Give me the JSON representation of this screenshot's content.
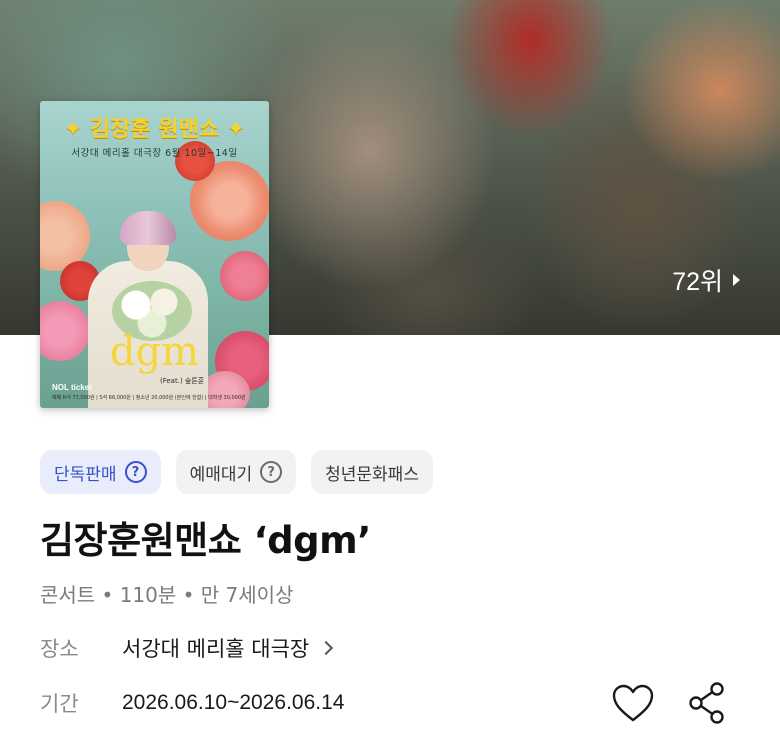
{
  "hero": {
    "rank_text": "72위",
    "rank_icon": "chevron-right-icon"
  },
  "poster": {
    "title": "✦ 김장훈 원맨쇼 ✦",
    "subtitle": "서강대 메리홀 대극장   6월 10일~14일",
    "logo_text": "dgm",
    "feat_text": "(Feat.) 숲튼훈",
    "brand": "NOL ticket",
    "fine_print": "예매 R석 77,000원 | S석 66,000원 | 청소년 20,000원 (본인에 한함) | 대학생 30,000원"
  },
  "tags": [
    {
      "label": "단독판매",
      "icon": "help-circle-icon",
      "primary": true
    },
    {
      "label": "예매대기",
      "icon": "help-circle-icon",
      "primary": false
    },
    {
      "label": "청년문화패스",
      "primary": false
    }
  ],
  "event": {
    "title": "김장훈원맨쇼 ‘dgm’",
    "meta": "콘서트 • 110분 • 만 7세이상",
    "venue_label": "장소",
    "venue": "서강대 메리홀 대극장",
    "period_label": "기간",
    "period": "2026.06.10~2026.06.14"
  },
  "actions": {
    "like_icon": "heart-icon",
    "share_icon": "share-icon"
  },
  "colors": {
    "primary_tag_bg": "#e9ecfb",
    "primary_tag_text": "#3552c9",
    "tag_bg": "#f2f2f4"
  }
}
